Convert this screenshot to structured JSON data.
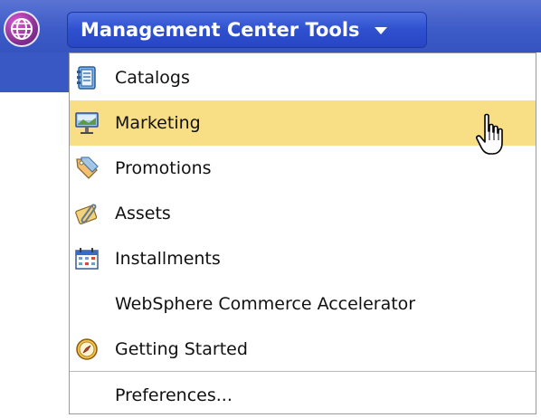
{
  "header": {
    "globe_icon": "globe-icon",
    "tools_button_label": "Management Center Tools"
  },
  "menu": {
    "items": [
      {
        "label": "Catalogs",
        "icon": "catalog-book-icon"
      },
      {
        "label": "Marketing",
        "icon": "billboard-icon",
        "highlighted": true
      },
      {
        "label": "Promotions",
        "icon": "price-tag-icon"
      },
      {
        "label": "Assets",
        "icon": "paperclip-icon"
      },
      {
        "label": "Installments",
        "icon": "calendar-icon"
      },
      {
        "label": "WebSphere Commerce Accelerator",
        "icon": ""
      },
      {
        "label": "Getting Started",
        "icon": "compass-icon"
      }
    ],
    "preferences_label": "Preferences..."
  },
  "colors": {
    "header_bg": "#3e5cc8",
    "highlight_bg": "#f8df85"
  }
}
